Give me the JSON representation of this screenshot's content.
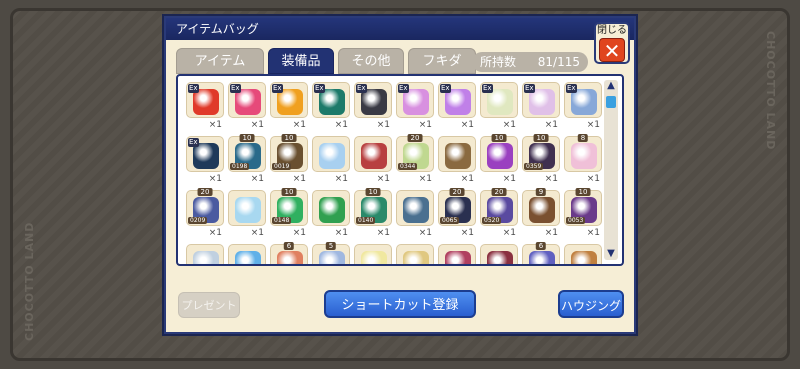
{
  "window": {
    "title": "アイテムバッグ",
    "close_label": "閉じる",
    "close_mark": "✕"
  },
  "watermark": "CHOCOTTO LAND",
  "tabs": [
    {
      "label": "アイテム",
      "active": false
    },
    {
      "label": "装備品",
      "active": true
    },
    {
      "label": "その他",
      "active": false
    },
    {
      "label": "フキダシ",
      "active": false
    }
  ],
  "capacity": {
    "label": "所持数",
    "value": "81/115"
  },
  "rows": [
    [
      {
        "qty": "×1",
        "ex": "Ex",
        "color": "#e03a2a",
        "icon": "red-wings"
      },
      {
        "qty": "×1",
        "ex": "Ex",
        "color": "#e64a7a",
        "icon": "pink-wings"
      },
      {
        "qty": "×1",
        "ex": "Ex",
        "color": "#f0a020",
        "icon": "golden-orb"
      },
      {
        "qty": "×1",
        "ex": "Ex",
        "color": "#1d7a6a",
        "icon": "teal-wings"
      },
      {
        "qty": "×1",
        "ex": "Ex",
        "color": "#3a3a44",
        "icon": "dark-wings"
      },
      {
        "qty": "×1",
        "ex": "Ex",
        "color": "#d890e0",
        "icon": "butterfly-wings"
      },
      {
        "qty": "×1",
        "ex": "Ex",
        "color": "#c080e8",
        "icon": "violet-wings"
      },
      {
        "qty": "×1",
        "ex": "Ex",
        "color": "#e0e8c0",
        "icon": "pale-wings"
      },
      {
        "qty": "×1",
        "ex": "Ex",
        "color": "#e0c0e8",
        "icon": "lilac-wings"
      },
      {
        "qty": "×1",
        "ex": "Ex",
        "color": "#88a8d8",
        "icon": "blue-wings"
      }
    ],
    [
      {
        "qty": "×1",
        "ex": "Ex",
        "color": "#1f3a5a",
        "icon": "navy-hat"
      },
      {
        "qty": "×1",
        "level": "10",
        "serial": "0198",
        "color": "#2a6a8a",
        "icon": "shark-armor"
      },
      {
        "qty": "×1",
        "level": "10",
        "serial": "0019",
        "color": "#6a5030",
        "icon": "bronze-armor"
      },
      {
        "qty": "×1",
        "color": "#a8d0f0",
        "icon": "ice-crystal"
      },
      {
        "qty": "×1",
        "color": "#b84040",
        "icon": "red-charm"
      },
      {
        "qty": "×1",
        "level": "20",
        "serial": "0344",
        "color": "#c0d890",
        "icon": "light-sword"
      },
      {
        "qty": "×1",
        "color": "#8a6a40",
        "icon": "brown-bow"
      },
      {
        "qty": "×1",
        "level": "10",
        "color": "#9a40c0",
        "icon": "purple-shield"
      },
      {
        "qty": "×1",
        "level": "10",
        "serial": "0359",
        "color": "#403050",
        "icon": "dark-boots"
      },
      {
        "qty": "×1",
        "level": "8",
        "color": "#f0c0d8",
        "icon": "pink-boots"
      }
    ],
    [
      {
        "qty": "×1",
        "level": "20",
        "serial": "0209",
        "color": "#4a5aa0",
        "icon": "royal-armor"
      },
      {
        "qty": "×1",
        "color": "#a8d8f0",
        "icon": "white-dress"
      },
      {
        "qty": "×1",
        "level": "10",
        "serial": "0148",
        "color": "#30b060",
        "icon": "green-crystal"
      },
      {
        "qty": "×1",
        "color": "#30a050",
        "icon": "clover"
      },
      {
        "qty": "×1",
        "level": "10",
        "serial": "0140",
        "color": "#2a8a6a",
        "icon": "green-beast"
      },
      {
        "qty": "×1",
        "color": "#4a7090",
        "icon": "steel-sword"
      },
      {
        "qty": "×1",
        "level": "20",
        "serial": "0065",
        "color": "#2a3050",
        "icon": "dark-armor"
      },
      {
        "qty": "×1",
        "level": "20",
        "serial": "0520",
        "color": "#5a4aa0",
        "icon": "mermaid-tail"
      },
      {
        "qty": "×1",
        "level": "9",
        "color": "#7a5030",
        "icon": "wooden-staff"
      },
      {
        "qty": "×1",
        "level": "10",
        "serial": "0053",
        "color": "#6a3a8a",
        "icon": "purple-robe"
      }
    ],
    [
      {
        "qty": "",
        "color": "#c0d0e0",
        "icon": "frost-item"
      },
      {
        "qty": "",
        "color": "#60b0e8",
        "icon": "blue-flower"
      },
      {
        "qty": "",
        "level": "6",
        "color": "#e08060",
        "icon": "coral-item"
      },
      {
        "qty": "",
        "level": "5",
        "color": "#a0b8e0",
        "icon": "pale-blue-item"
      },
      {
        "qty": "",
        "color": "#f0e8a0",
        "icon": "yellow-item"
      },
      {
        "qty": "",
        "color": "#e0c880",
        "icon": "gold-item"
      },
      {
        "qty": "",
        "color": "#b04060",
        "icon": "crimson-item"
      },
      {
        "qty": "",
        "color": "#8a3040",
        "icon": "wine-item"
      },
      {
        "qty": "",
        "level": "6",
        "color": "#6060c0",
        "icon": "indigo-item"
      },
      {
        "qty": "",
        "color": "#c08040",
        "icon": "amber-item"
      }
    ]
  ],
  "buttons": {
    "present": "プレゼント",
    "shortcut": "ショートカット登録",
    "housing": "ハウジング"
  },
  "scroll": {
    "up": "▲",
    "down": "▼",
    "accent": "#3aa0e0"
  }
}
